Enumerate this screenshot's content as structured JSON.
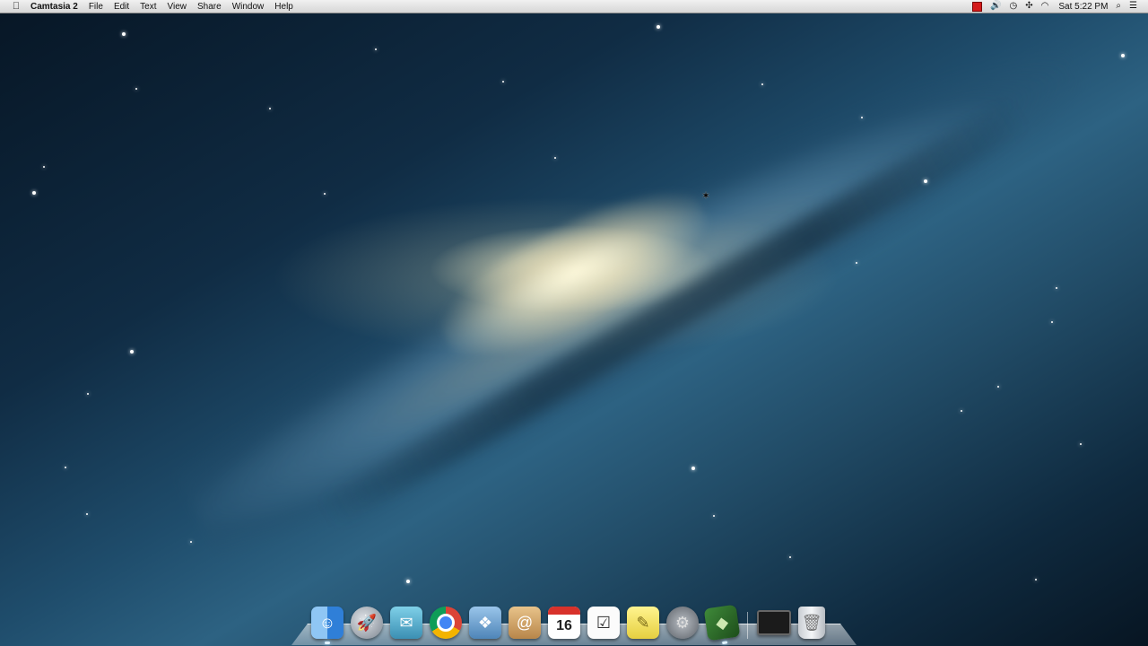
{
  "menubar": {
    "apple_icon": "apple-icon",
    "app_name": "Camtasia 2",
    "menus": [
      "File",
      "Edit",
      "Text",
      "View",
      "Share",
      "Window",
      "Help"
    ],
    "status": {
      "recording_icon": "record-icon",
      "volume_icon": "volume-icon",
      "time_machine_icon": "time-machine-icon",
      "bluetooth_icon": "bluetooth-icon",
      "wifi_icon": "wifi-icon",
      "clock": "Sat 5:22 PM",
      "spotlight_icon": "search-icon",
      "notifications_icon": "list-icon"
    }
  },
  "dock": {
    "apps": [
      {
        "name": "Finder",
        "icon": "finder-icon",
        "running": true
      },
      {
        "name": "Launchpad",
        "icon": "rocket-icon",
        "running": false
      },
      {
        "name": "Mail",
        "icon": "mail-icon",
        "running": false
      },
      {
        "name": "Google Chrome",
        "icon": "chrome-icon",
        "running": false
      },
      {
        "name": "Preview",
        "icon": "preview-icon",
        "running": false
      },
      {
        "name": "Contacts",
        "icon": "contacts-icon",
        "running": false
      },
      {
        "name": "Calendar",
        "icon": "calendar-icon",
        "day": "16",
        "running": false
      },
      {
        "name": "Reminders",
        "icon": "reminders-icon",
        "running": false
      },
      {
        "name": "Notes",
        "icon": "notes-icon",
        "running": false
      },
      {
        "name": "System Preferences",
        "icon": "gear-icon",
        "running": false
      },
      {
        "name": "Camtasia 2",
        "icon": "camtasia-icon",
        "running": true
      }
    ],
    "right": [
      {
        "name": "Screen Recording",
        "icon": "monitor-icon"
      },
      {
        "name": "Trash",
        "icon": "trash-icon"
      }
    ]
  }
}
